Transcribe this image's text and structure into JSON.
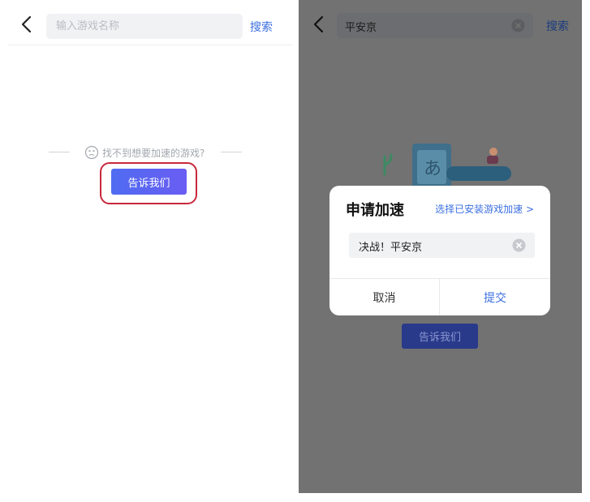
{
  "left": {
    "search": {
      "placeholder": "输入游戏名称",
      "button_label": "搜索"
    },
    "empty_state": {
      "message": "找不到想要加速的游戏?",
      "button_label": "告诉我们"
    },
    "highlight_color": "#c8283b"
  },
  "right": {
    "search": {
      "value": "平安京",
      "button_label": "搜索"
    },
    "dialog": {
      "title": "申请加速",
      "link_label": "选择已安装游戏加速 >",
      "input_value": "决战！平安京",
      "cancel_label": "取消",
      "submit_label": "提交"
    },
    "background_button_label": "告诉我们"
  },
  "colors": {
    "accent": "#3b6fe0",
    "button_gradient_start": "#4f6cf1",
    "button_gradient_end": "#6a5df3"
  }
}
